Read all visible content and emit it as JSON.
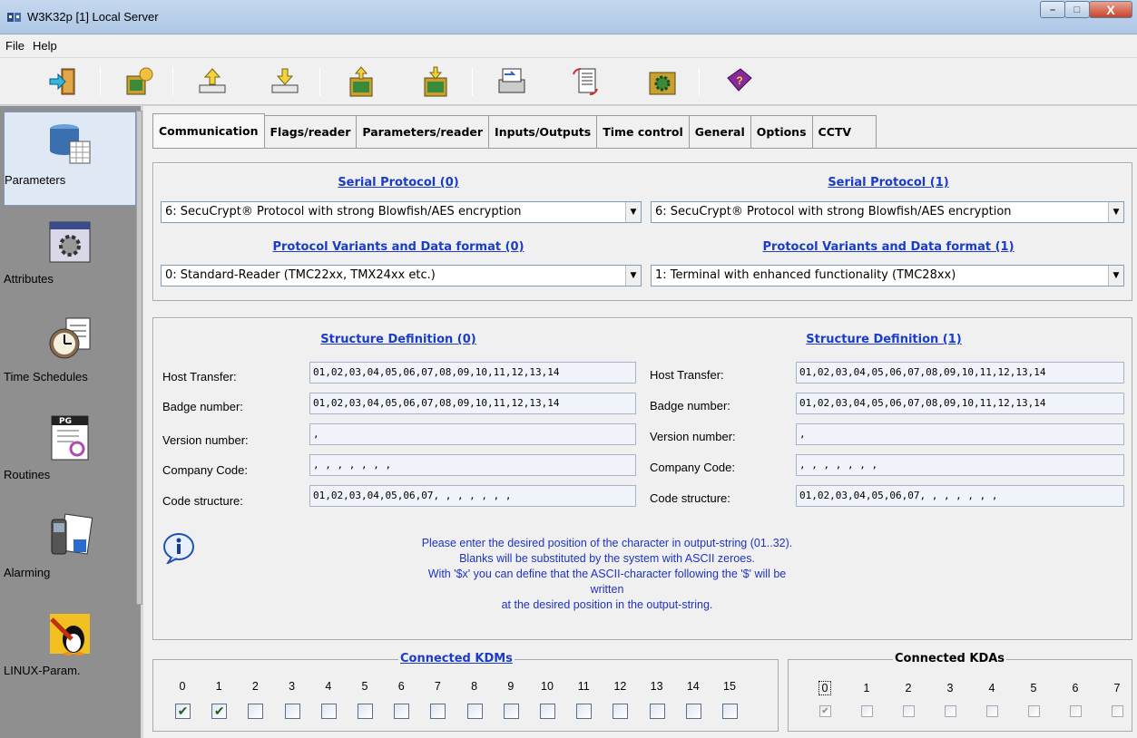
{
  "window": {
    "title": "W3K32p [1] Local Server",
    "minimize": "–",
    "maximize": "□",
    "close": "X"
  },
  "menu": [
    "File",
    "Help"
  ],
  "toolbar": {
    "icons": [
      "exit-door-icon",
      "reader-info-icon",
      "upload-icon",
      "download-icon",
      "upload-reader-icon",
      "download-reader-icon",
      "transfer-icon",
      "document-sync-icon",
      "reader-gear-icon",
      "help-book-icon"
    ]
  },
  "sidebar": {
    "items": [
      {
        "label": "Parameters",
        "icon": "database-tools-icon",
        "active": true
      },
      {
        "label": "Attributes",
        "icon": "gear-window-icon",
        "active": false
      },
      {
        "label": "Time Schedules",
        "icon": "clock-schedule-icon",
        "active": false
      },
      {
        "label": "Routines",
        "icon": "routine-program-icon",
        "active": false
      },
      {
        "label": "Alarming",
        "icon": "alarm-phone-icon",
        "active": false
      },
      {
        "label": "LINUX-Param.",
        "icon": "linux-tux-icon",
        "active": false
      }
    ]
  },
  "tabs": [
    "Communication",
    "Flags/reader",
    "Parameters/reader",
    "Inputs/Outputs",
    "Time control",
    "General",
    "Options",
    "CCTV"
  ],
  "protocol": {
    "serial0_heading": "Serial Protocol (0)",
    "serial1_heading": "Serial Protocol (1)",
    "serial0_value": "6: SecuCrypt® Protocol with strong Blowfish/AES encryption",
    "serial1_value": "6: SecuCrypt® Protocol with strong Blowfish/AES encryption",
    "variant0_heading": "Protocol Variants and Data format (0)",
    "variant1_heading": "Protocol Variants and Data format (1)",
    "variant0_value": "0: Standard-Reader (TMC22xx, TMX24xx etc.)",
    "variant1_value": "1: Terminal with enhanced functionality (TMC28xx)"
  },
  "structure": {
    "heading0": "Structure Definition (0)",
    "heading1": "Structure Definition (1)",
    "left": {
      "host_transfer_label": "Host Transfer:",
      "host_transfer": "01,02,03,04,05,06,07,08,09,10,11,12,13,14",
      "badge_label": "Badge number:",
      "badge": "01,02,03,04,05,06,07,08,09,10,11,12,13,14",
      "version_label": "Version number:",
      "version": " ,",
      "company_label": "Company Code:",
      "company": " ,  ,  ,  ,  ,  ,  ,",
      "code_label": "Code structure:",
      "code": "01,02,03,04,05,06,07,  ,  ,  ,  ,  ,  ,"
    },
    "right": {
      "host_transfer_label": "Host Transfer:",
      "host_transfer": "01,02,03,04,05,06,07,08,09,10,11,12,13,14",
      "badge_label": "Badge number:",
      "badge": "01,02,03,04,05,06,07,08,09,10,11,12,13,14",
      "version_label": "Version number:",
      "version": " ,",
      "company_label": "Company Code:",
      "company": " ,  ,  ,  ,  ,  ,  ,",
      "code_label": "Code structure:",
      "code": "01,02,03,04,05,06,07,  ,  ,  ,  ,  ,  ,"
    },
    "info": [
      "Please enter the desired position of the character in output-string (01..32).",
      "Blanks will be substituted by the system with ASCII zeroes.",
      "With '$x' you can define that the ASCII-character following the '$' will be written",
      "at the desired position in the output-string."
    ]
  },
  "kdms": {
    "title": "Connected KDMs",
    "numbers": [
      "0",
      "1",
      "2",
      "3",
      "4",
      "5",
      "6",
      "7",
      "8",
      "9",
      "10",
      "11",
      "12",
      "13",
      "14",
      "15"
    ],
    "checked": [
      true,
      true,
      false,
      false,
      false,
      false,
      false,
      false,
      false,
      false,
      false,
      false,
      false,
      false,
      false,
      false
    ]
  },
  "kdas": {
    "title": "Connected KDAs",
    "numbers": [
      "0",
      "1",
      "2",
      "3",
      "4",
      "5",
      "6",
      "7"
    ],
    "checked": [
      true,
      false,
      false,
      false,
      false,
      false,
      false,
      false
    ]
  }
}
